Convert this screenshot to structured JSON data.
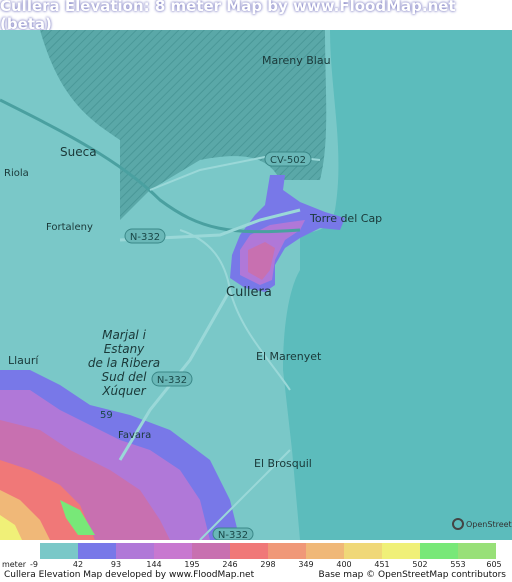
{
  "title": "Cullera Elevation: 8 meter Map by www.FloodMap.net (beta)",
  "map": {
    "places": [
      {
        "name": "Mareny Blau"
      },
      {
        "name": "Sueca"
      },
      {
        "name": "Riola"
      },
      {
        "name": "Fortaleny"
      },
      {
        "name": "Torre del Cap"
      },
      {
        "name": "Cullera"
      },
      {
        "name": "El Marenyet"
      },
      {
        "name": "Llaurí"
      },
      {
        "name": "Favara"
      },
      {
        "name": "El Brosquil"
      }
    ],
    "marsh_label": [
      "Marjal i",
      "Estany",
      "de la Ribera",
      "Sud del",
      "Xúquer"
    ],
    "roads": [
      "CV-502",
      "N-332",
      "N-332",
      "N-332"
    ],
    "road_number": "59"
  },
  "legend": {
    "unit_label": "meter",
    "ticks": [
      "-9",
      "42",
      "93",
      "144",
      "195",
      "246",
      "298",
      "349",
      "400",
      "451",
      "502",
      "553",
      "605"
    ],
    "colors": [
      "#7ac8c8",
      "#7878e8",
      "#b078d8",
      "#c878d0",
      "#c870b0",
      "#f07878",
      "#f09878",
      "#f0b878",
      "#f0d878",
      "#f0f078",
      "#78e878",
      "#98e078"
    ]
  },
  "footer": {
    "left": "Cullera Elevation Map developed by www.FloodMap.net",
    "right": "Base map © OpenStreetMap contributors",
    "osm_logo": "OpenStreetMap"
  }
}
